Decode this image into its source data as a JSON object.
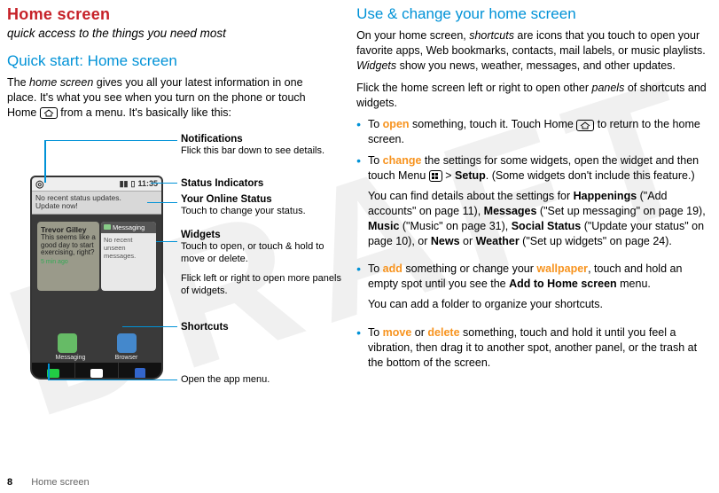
{
  "watermark": "DRAFT",
  "left": {
    "title": "Home screen",
    "subtitle": "quick access to the things you need most",
    "quick_start_heading": "Quick start: Home screen",
    "intro_a": "The ",
    "intro_italic": "home screen",
    "intro_b": " gives you all your latest information in one place. It's what you see when you turn on the phone or touch Home ",
    "intro_c": " from a menu. It's basically like this:"
  },
  "diagram": {
    "phone": {
      "time": "11:35",
      "online_status_line1": "No recent status updates.",
      "online_status_line2": "Update now!",
      "widget_card": {
        "name": "Trevor Gilley",
        "text": "This seems like a good day to start exercising, right?",
        "ago": "5 min ago"
      },
      "msg_card": {
        "header": "Messaging",
        "body": "No recent unseen messages."
      },
      "dock": {
        "shortcut1": "Messaging",
        "shortcut2": "Browser"
      }
    },
    "callouts": {
      "notifications_title": "Notifications",
      "notifications_body": "Flick this bar down to see details.",
      "status_indicators_title": "Status Indicators",
      "your_online_status_title": "Your Online Status",
      "your_online_status_body": "Touch to change your status.",
      "widgets_title": "Widgets",
      "widgets_body": "Touch to open, or touch & hold to move or delete.",
      "flick_panels": "Flick left or right to open more panels of widgets.",
      "shortcuts_title": "Shortcuts",
      "open_app_menu": "Open the app menu."
    }
  },
  "right": {
    "heading": "Use & change your home screen",
    "p1_a": "On your home screen, ",
    "p1_i1": "shortcuts",
    "p1_b": " are icons that you touch to open your favorite apps, Web bookmarks, contacts, mail labels, or music playlists. ",
    "p1_i2": "Widgets",
    "p1_c": " show you news, weather, messages, and other updates.",
    "p2_a": "Flick the home screen left or right to open other ",
    "p2_i": "panels",
    "p2_b": " of shortcuts and widgets.",
    "b1_a": "To ",
    "b1_action": "open",
    "b1_b": " something, touch it. Touch Home ",
    "b1_c": " to return to the home screen.",
    "b2_a": "To ",
    "b2_action": "change",
    "b2_b": " the settings for some widgets, open the widget and then touch Menu ",
    "b2_c": " > ",
    "b2_setup": "Setup",
    "b2_d": ". (Some widgets don't include this feature.)",
    "b2_sub_a": "You can find details about the settings for ",
    "b2_sub_b": " (\"Add accounts\" on page 11), ",
    "b2_sub_c": " (\"Set up messaging\" on page 19), ",
    "b2_sub_d": " (\"Music\" on page 31), ",
    "b2_sub_e": " (\"Update your status\" on page 10), or ",
    "b2_sub_f": " or ",
    "b2_sub_g": " (\"Set up widgets\" on page 24).",
    "happenings": "Happenings",
    "messages": "Messages",
    "music": "Music",
    "social_status": "Social Status",
    "news": "News",
    "weather": "Weather",
    "b3_a": "To ",
    "b3_action": "add",
    "b3_b": " something or change your ",
    "b3_wallpaper": "wallpaper",
    "b3_c": ", touch and hold an empty spot until you see the ",
    "b3_add_to_home": "Add to Home screen",
    "b3_d": " menu.",
    "b3_sub": "You can add a folder to organize your shortcuts.",
    "b4_a": "To ",
    "b4_action1": "move",
    "b4_or": " or ",
    "b4_action2": "delete",
    "b4_b": " something, touch and hold it until you feel a vibration, then drag it to another spot, another panel, or the trash at the bottom of the screen."
  },
  "footer": {
    "page_number": "8",
    "section": "Home screen"
  }
}
